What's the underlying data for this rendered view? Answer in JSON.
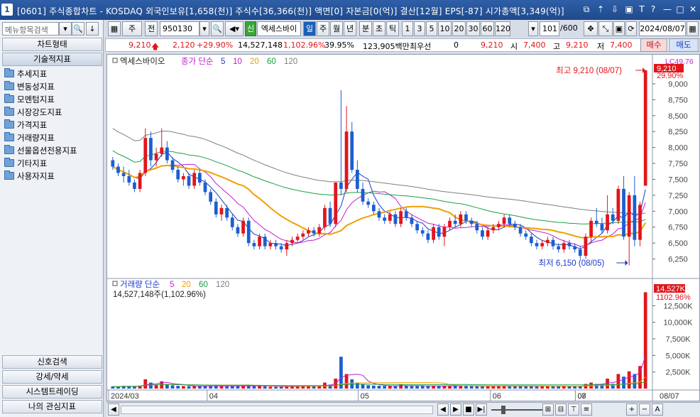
{
  "window": {
    "badge": "1",
    "title": "[0601] 주식종합차트 - KOSDAQ 외국인보유[1,658(천)] 주식수[36,366(천)] 액면[0] 자본금[0(억)] 결산[12월] EPS[-87] 시가총액[3,349(억)]",
    "buttons": [
      "⧉",
      "⇡",
      "⇩",
      "▣",
      "T",
      "?",
      "—",
      "□",
      "✕"
    ]
  },
  "left": {
    "search_placeholder": "메뉴항목검색",
    "top_tabs": [
      "차트형태",
      "기술적지표"
    ],
    "tree": [
      "추세지표",
      "변동성지표",
      "모멘텀지표",
      "시장강도지표",
      "가격지표",
      "거래량지표",
      "선물옵션전용지표",
      "기타지표",
      "사용자지표"
    ],
    "bottom_tabs": [
      "신호검색",
      "강세/약세",
      "시스템트레이딩",
      "나의 관심지표"
    ]
  },
  "toolbar": {
    "period": "주",
    "prev": "전",
    "code": "950130",
    "credit_badge": "신",
    "stock_name": "엑세스바이오",
    "periods": [
      "일",
      "주",
      "월",
      "년",
      "분",
      "초",
      "틱"
    ],
    "active_period": "일",
    "intervals": [
      "1",
      "3",
      "5",
      "10",
      "20",
      "30",
      "60",
      "120"
    ],
    "count": "101",
    "count_total": "/600",
    "date": "2024/08/07",
    "buy": "매수",
    "sell": "매도"
  },
  "quote": {
    "price": "9,210",
    "change": "2,120",
    "change_pct": "+29.90%",
    "volume": "14,527,148",
    "volume_pct": "1,102.96%",
    "turnover_pct": "39.95%",
    "amount": "123,905백만",
    "market_label": "최우선",
    "zero": "0",
    "best": "9,210",
    "open_label": "시",
    "open": "7,400",
    "high_label": "고",
    "high": "9,210",
    "low_label": "저",
    "low": "7,400"
  },
  "chart_data": {
    "type": "candlestick",
    "price_panel": {
      "name": "엑세스바이오",
      "legend_label": "종가 단순",
      "ma_periods": [
        "5",
        "10",
        "20",
        "60",
        "120"
      ],
      "ma_colors": [
        "#1b39c9",
        "#c21fd0",
        "#f0a000",
        "#1aa043",
        "#7f7f7f"
      ],
      "y_ticks": [
        "9,000",
        "8,750",
        "8,500",
        "8,250",
        "8,000",
        "7,750",
        "7,500",
        "7,250",
        "7,000",
        "6,750",
        "6,500",
        "6,250"
      ],
      "ylim": [
        6000,
        9300
      ],
      "top_label": "LC49.76",
      "current_price": "9,210",
      "current_pct": "29.90%",
      "max_label": "최고 9,210 (08/07)",
      "min_label": "최저 6,150 (08/05)"
    },
    "volume_panel": {
      "title": "거래량 단순",
      "ma_periods": [
        "5",
        "20",
        "60",
        "120"
      ],
      "value_label": "14,527,148주(1,102.96%)",
      "y_ticks": [
        "12,500K",
        "10,000K",
        "7,500K",
        "5,000K",
        "2,500K"
      ],
      "ylim": [
        0,
        15000
      ],
      "current": "14,527K",
      "current_pct": "1102.96%"
    },
    "x_ticks": [
      "2024/03",
      "04",
      "05",
      "06",
      "07",
      "08",
      "08/07"
    ],
    "candles": [
      [
        7800,
        7850,
        7650,
        7700,
        320
      ],
      [
        7700,
        7750,
        7550,
        7600,
        280
      ],
      [
        7600,
        7700,
        7450,
        7550,
        400
      ],
      [
        7550,
        7650,
        7400,
        7450,
        350
      ],
      [
        7450,
        7500,
        7300,
        7350,
        300
      ],
      [
        7350,
        7650,
        7300,
        7600,
        450
      ],
      [
        7600,
        8300,
        7550,
        8150,
        1400
      ],
      [
        8150,
        8250,
        7700,
        7800,
        900
      ],
      [
        7800,
        8000,
        7700,
        7900,
        600
      ],
      [
        7900,
        8300,
        7850,
        8000,
        1100
      ],
      [
        8000,
        8100,
        7750,
        7800,
        700
      ],
      [
        7800,
        7850,
        7600,
        7650,
        500
      ],
      [
        7650,
        7700,
        7450,
        7500,
        420
      ],
      [
        7500,
        7600,
        7400,
        7550,
        380
      ],
      [
        7550,
        7600,
        7350,
        7400,
        360
      ],
      [
        7400,
        7650,
        7350,
        7600,
        400
      ],
      [
        7600,
        7650,
        7400,
        7450,
        380
      ],
      [
        7450,
        7500,
        7250,
        7300,
        420
      ],
      [
        7300,
        7350,
        7100,
        7150,
        400
      ],
      [
        7150,
        7200,
        6900,
        6950,
        450
      ],
      [
        6950,
        7100,
        6850,
        7050,
        380
      ],
      [
        7050,
        7100,
        6850,
        6900,
        350
      ],
      [
        6900,
        6950,
        6700,
        6750,
        400
      ],
      [
        6750,
        6800,
        6600,
        6650,
        380
      ],
      [
        6650,
        6900,
        6600,
        6850,
        450
      ],
      [
        6850,
        6900,
        6450,
        6500,
        500
      ],
      [
        6500,
        6550,
        6400,
        6450,
        380
      ],
      [
        6450,
        6650,
        6400,
        6600,
        420
      ],
      [
        6600,
        6650,
        6400,
        6450,
        360
      ],
      [
        6450,
        6550,
        6400,
        6500,
        300
      ],
      [
        6500,
        6550,
        6400,
        6450,
        280
      ],
      [
        6450,
        6500,
        6350,
        6400,
        300
      ],
      [
        6400,
        6550,
        6300,
        6500,
        360
      ],
      [
        6500,
        6600,
        6450,
        6550,
        380
      ],
      [
        6550,
        6650,
        6500,
        6600,
        360
      ],
      [
        6600,
        6700,
        6550,
        6650,
        380
      ],
      [
        6650,
        6750,
        6600,
        6700,
        360
      ],
      [
        6700,
        6750,
        6600,
        6650,
        340
      ],
      [
        6650,
        6800,
        6600,
        6750,
        400
      ],
      [
        6750,
        7100,
        6700,
        7050,
        900
      ],
      [
        7050,
        7150,
        6750,
        6800,
        600
      ],
      [
        6800,
        7450,
        6750,
        7450,
        1500
      ],
      [
        7450,
        8900,
        7250,
        7350,
        4800
      ],
      [
        7350,
        8650,
        7300,
        8250,
        2200
      ],
      [
        8250,
        8400,
        7600,
        7650,
        1400
      ],
      [
        7650,
        7800,
        7300,
        7350,
        900
      ],
      [
        7350,
        7450,
        7100,
        7150,
        700
      ],
      [
        7150,
        7200,
        7050,
        7100,
        500
      ],
      [
        7100,
        7150,
        6950,
        7000,
        450
      ],
      [
        7000,
        7050,
        6850,
        6900,
        420
      ],
      [
        6900,
        6950,
        6800,
        6850,
        400
      ],
      [
        6850,
        7000,
        6800,
        6950,
        380
      ],
      [
        6950,
        7000,
        6750,
        6800,
        400
      ],
      [
        6800,
        7050,
        6750,
        7000,
        600
      ],
      [
        7000,
        7050,
        6850,
        6900,
        420
      ],
      [
        6900,
        6950,
        6750,
        6800,
        380
      ],
      [
        6800,
        6850,
        6650,
        6700,
        400
      ],
      [
        6700,
        6750,
        6600,
        6650,
        380
      ],
      [
        6650,
        6700,
        6500,
        6550,
        400
      ],
      [
        6550,
        6800,
        6500,
        6750,
        420
      ],
      [
        6750,
        6800,
        6550,
        6600,
        380
      ],
      [
        6600,
        6800,
        6450,
        6750,
        400
      ],
      [
        6750,
        6900,
        6700,
        6850,
        450
      ],
      [
        6850,
        6950,
        6750,
        6800,
        420
      ],
      [
        6800,
        7000,
        6750,
        6950,
        480
      ],
      [
        6950,
        7000,
        6800,
        6850,
        420
      ],
      [
        6850,
        6900,
        6750,
        6800,
        380
      ],
      [
        6800,
        6850,
        6650,
        6700,
        360
      ],
      [
        6700,
        6750,
        6550,
        6600,
        340
      ],
      [
        6600,
        6750,
        6550,
        6700,
        380
      ],
      [
        6700,
        6800,
        6650,
        6750,
        360
      ],
      [
        6750,
        6850,
        6700,
        6800,
        380
      ],
      [
        6800,
        6950,
        6750,
        6900,
        450
      ],
      [
        6900,
        6950,
        6750,
        6800,
        400
      ],
      [
        6800,
        6850,
        6700,
        6750,
        360
      ],
      [
        6750,
        6800,
        6600,
        6650,
        380
      ],
      [
        6650,
        6700,
        6550,
        6600,
        360
      ],
      [
        6600,
        6650,
        6450,
        6500,
        400
      ],
      [
        6500,
        6550,
        6400,
        6450,
        380
      ],
      [
        6450,
        6550,
        6400,
        6500,
        360
      ],
      [
        6500,
        6600,
        6450,
        6550,
        360
      ],
      [
        6550,
        6600,
        6400,
        6450,
        380
      ],
      [
        6450,
        6500,
        6350,
        6400,
        360
      ],
      [
        6400,
        6550,
        6350,
        6500,
        380
      ],
      [
        6500,
        6550,
        6400,
        6450,
        340
      ],
      [
        6450,
        6500,
        6350,
        6400,
        360
      ],
      [
        6400,
        6450,
        6250,
        6300,
        400
      ],
      [
        6300,
        6650,
        6250,
        6600,
        700
      ],
      [
        6600,
        6900,
        6500,
        6850,
        900
      ],
      [
        6850,
        7050,
        6750,
        6800,
        700
      ],
      [
        6800,
        6900,
        6650,
        6700,
        600
      ],
      [
        6700,
        7250,
        6650,
        6950,
        1500
      ],
      [
        6950,
        7050,
        6800,
        6850,
        700
      ],
      [
        6850,
        7400,
        6800,
        7350,
        2200
      ],
      [
        7350,
        7550,
        6550,
        6600,
        1800
      ],
      [
        6600,
        7300,
        6150,
        7250,
        2600
      ],
      [
        7250,
        7550,
        6450,
        6550,
        2200
      ],
      [
        6550,
        7150,
        6450,
        7100,
        3400
      ],
      [
        7400,
        9210,
        7400,
        9210,
        14527
      ]
    ]
  },
  "bottom": {
    "buttons": [
      "◀",
      "▶",
      "▶▶",
      "■",
      "▶|",
      "⊣",
      "⊢",
      "⊞",
      "⊟",
      "⊤",
      "≡",
      "+",
      "−",
      "A"
    ]
  }
}
